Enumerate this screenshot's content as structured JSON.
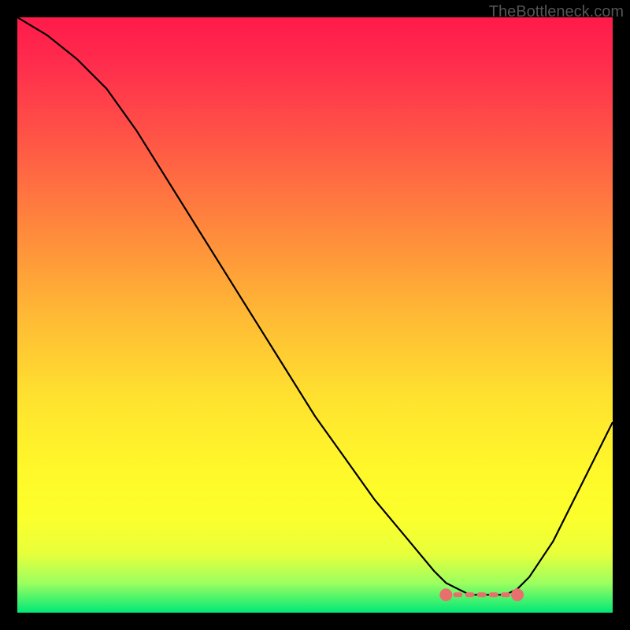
{
  "watermark": "TheBottleneck.com",
  "chart_data": {
    "type": "line",
    "title": "",
    "xlabel": "",
    "ylabel": "",
    "xlim": [
      0,
      100
    ],
    "ylim": [
      0,
      100
    ],
    "x": [
      0,
      5,
      10,
      15,
      20,
      25,
      30,
      35,
      40,
      45,
      50,
      55,
      60,
      65,
      70,
      72,
      74,
      76,
      78,
      80,
      82,
      84,
      86,
      90,
      95,
      100
    ],
    "values": [
      100,
      97,
      93,
      88,
      81,
      73,
      65,
      57,
      49,
      41,
      33,
      26,
      19,
      13,
      7,
      5,
      4,
      3,
      3,
      3,
      3,
      4,
      6,
      12,
      22,
      32
    ],
    "annotation": {
      "type": "flat-region-markers",
      "x_start": 72,
      "x_end": 84,
      "y": 3,
      "color": "#e96f6f"
    },
    "gradient_stops": [
      {
        "pos": 0.0,
        "color": "#ff1a4a"
      },
      {
        "pos": 0.5,
        "color": "#ffe22f"
      },
      {
        "pos": 0.9,
        "color": "#e8ff3a"
      },
      {
        "pos": 1.0,
        "color": "#00e878"
      }
    ]
  }
}
